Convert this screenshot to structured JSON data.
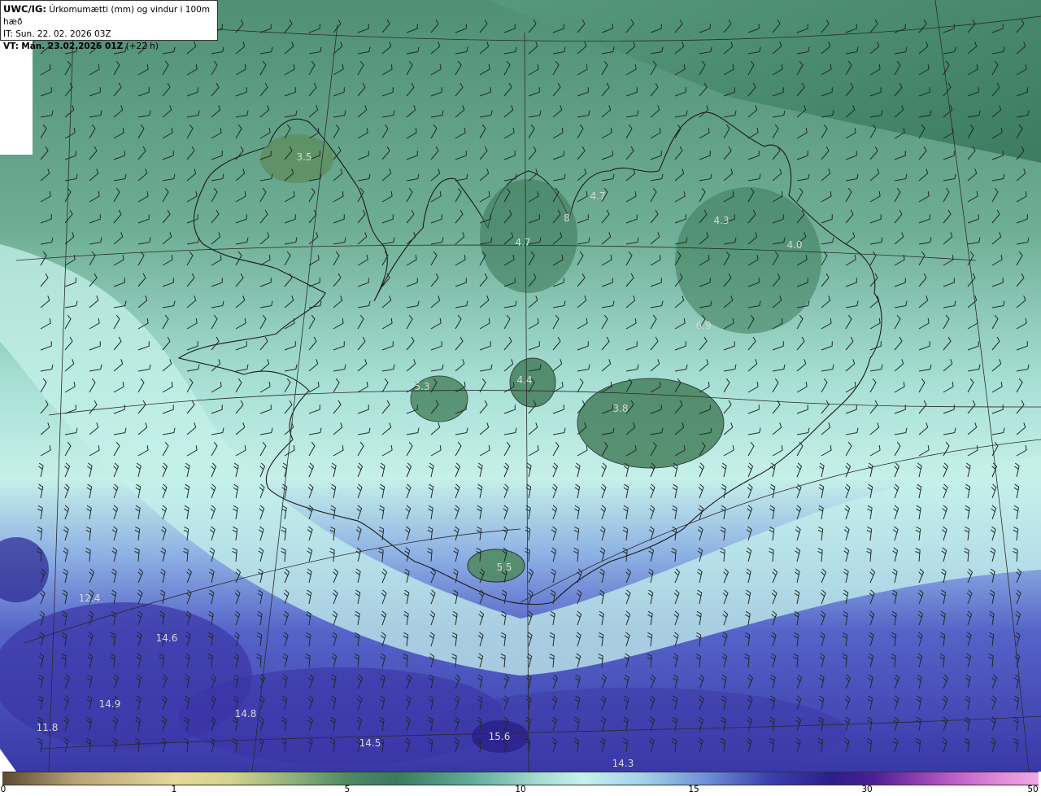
{
  "header": {
    "model_prefix": "UWC/IG:",
    "title": "Úrkomumætti (mm) og vindur i 100m hæð",
    "init_time": "IT: Sun. 22. 02. 2026 03Z",
    "valid_prefix": "VT:",
    "valid_time": "Mán. 23.02.2026 01Z",
    "lead_time": "(+22 h)"
  },
  "colorbar": {
    "ticks": [
      {
        "label": "0",
        "value": 0
      },
      {
        "label": "1",
        "value": 1
      },
      {
        "label": "5",
        "value": 5
      },
      {
        "label": "10",
        "value": 10
      },
      {
        "label": "15",
        "value": 15
      },
      {
        "label": "30",
        "value": 30
      },
      {
        "label": "50",
        "value": 50
      }
    ]
  },
  "max_labels": [
    {
      "text": "3.5",
      "place": "westfjords"
    },
    {
      "text": "4.7",
      "place": "north-central-a"
    },
    {
      "text": "4.7",
      "place": "north-central-b"
    },
    {
      "text": "8",
      "place": "north-central-c"
    },
    {
      "text": "4.3",
      "place": "northeast"
    },
    {
      "text": "4.0",
      "place": "east"
    },
    {
      "text": "6.9",
      "place": "east-interior"
    },
    {
      "text": "5.3",
      "place": "west-interior"
    },
    {
      "text": "4.4",
      "place": "central-interior"
    },
    {
      "text": "3.8",
      "place": "vatnajokull"
    },
    {
      "text": "5.5",
      "place": "south-myrdalsjokull"
    },
    {
      "text": "12.4",
      "place": "sw-ocean-a"
    },
    {
      "text": "14.6",
      "place": "sw-ocean-b"
    },
    {
      "text": "14.9",
      "place": "sw-ocean-c"
    },
    {
      "text": "14.8",
      "place": "s-ocean-a"
    },
    {
      "text": "11.8",
      "place": "sw-ocean-d"
    },
    {
      "text": "14.5",
      "place": "s-ocean-b"
    },
    {
      "text": "15.6",
      "place": "s-ocean-c"
    },
    {
      "text": "14.3",
      "place": "s-ocean-d"
    }
  ],
  "colors": {
    "land_green": "#3f7f62",
    "coast_light": "#b8ece6",
    "ocean_blue": "#4a52c0",
    "deep_blue": "#2a1f8a"
  }
}
